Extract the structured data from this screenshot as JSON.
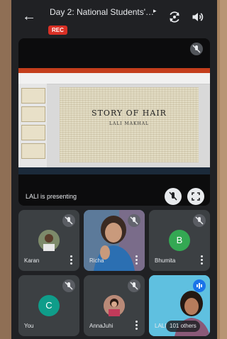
{
  "header": {
    "title": "Day 2: National Students' Se...",
    "rec_label": "REC"
  },
  "presentation": {
    "slide_title": "STORY OF  HAIR",
    "slide_subtitle": "LALI MAKHAL",
    "presenting_label": "LALI is presenting"
  },
  "participants": [
    {
      "name": "Karan",
      "type": "photo"
    },
    {
      "name": "Richa",
      "type": "video"
    },
    {
      "name": "Bhumita",
      "type": "initial",
      "initial": "B",
      "color": "#34a853"
    },
    {
      "name": "You",
      "type": "initial",
      "initial": "C",
      "color": "#0f9d8a"
    },
    {
      "name": "AnnaJuhi",
      "type": "photo"
    },
    {
      "name": "LALI",
      "type": "video"
    }
  ],
  "others_label": "101 others",
  "colors": {
    "background": "#202124",
    "tile": "#3c4043",
    "rec": "#d93025",
    "speaking": "#1a73e8"
  },
  "icons": {
    "back": "arrow-left-icon",
    "switch_camera": "switch-camera-icon",
    "audio": "speaker-icon",
    "mic_off": "mic-off-icon",
    "fullscreen": "fullscreen-icon",
    "more": "more-vert-icon"
  }
}
